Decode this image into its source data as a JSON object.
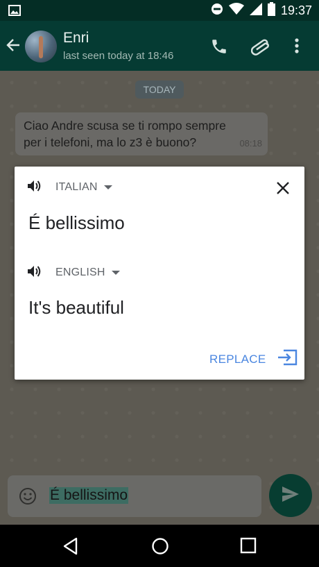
{
  "status_bar": {
    "time": "19:37",
    "icons": [
      "gallery-icon",
      "do-not-disturb-icon",
      "wifi-icon",
      "signal-icon",
      "battery-icon"
    ]
  },
  "app_bar": {
    "contact_name": "Enri",
    "last_seen": "last seen today at 18:46",
    "icons": [
      "back-arrow-icon",
      "call-icon",
      "attach-icon",
      "more-vert-icon"
    ]
  },
  "chat": {
    "date_chip": "TODAY",
    "messages": [
      {
        "line1": "Ciao Andre scusa se ti rompo sempre",
        "line2": "per i telefoni, ma lo z3 è buono?",
        "time": "08:18"
      }
    ]
  },
  "translate_dialog": {
    "source": {
      "language": "ITALIAN",
      "text": "É bellissimo"
    },
    "target": {
      "language": "ENGLISH",
      "text": "It's beautiful"
    },
    "replace_label": "REPLACE"
  },
  "input": {
    "value": "É bellissimo"
  },
  "colors": {
    "status_bar": "#042d25",
    "app_bar": "#053b33",
    "accent_blue": "#4a86e0",
    "send_button": "#073d31",
    "chat_bg": "#5d5a52"
  }
}
